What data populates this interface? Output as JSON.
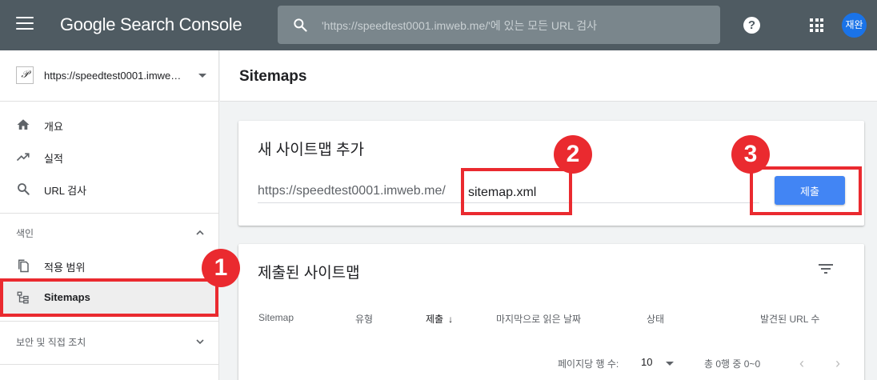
{
  "topbar": {
    "brand": "Google Search Console",
    "search_placeholder": "'https://speedtest0001.imweb.me/'에 있는 모든 URL 검사",
    "help": "?",
    "avatar": "재완"
  },
  "sidebar": {
    "property": "https://speedtest0001.imwe…",
    "items": [
      {
        "label": "개요"
      },
      {
        "label": "실적"
      },
      {
        "label": "URL 검사"
      }
    ],
    "section_index": "색인",
    "index_items": [
      {
        "label": "적용 범위"
      },
      {
        "label": "Sitemaps"
      }
    ],
    "section_security": "보안 및 직접 조치"
  },
  "main": {
    "page_title": "Sitemaps",
    "add_card": {
      "title": "새 사이트맵 추가",
      "url_prefix": "https://speedtest0001.imweb.me/",
      "input_value": "sitemap.xml",
      "submit_label": "제출"
    },
    "submitted_card": {
      "title": "제출된 사이트맵",
      "columns": [
        "Sitemap",
        "유형",
        "제출",
        "마지막으로 읽은 날짜",
        "상태",
        "발견된 URL 수"
      ],
      "sort_arrow": "↓",
      "rows_per_page_label": "페이지당 행 수:",
      "rows_per_page_value": "10",
      "range_label": "총 0행 중 0~0",
      "prev": "‹",
      "next": "›"
    }
  },
  "annotations": {
    "badge1": "1",
    "badge2": "2",
    "badge3": "3"
  },
  "colors": {
    "topbar": "#4f5b62",
    "accent": "#4285f4",
    "highlight": "#ea2a2f"
  }
}
